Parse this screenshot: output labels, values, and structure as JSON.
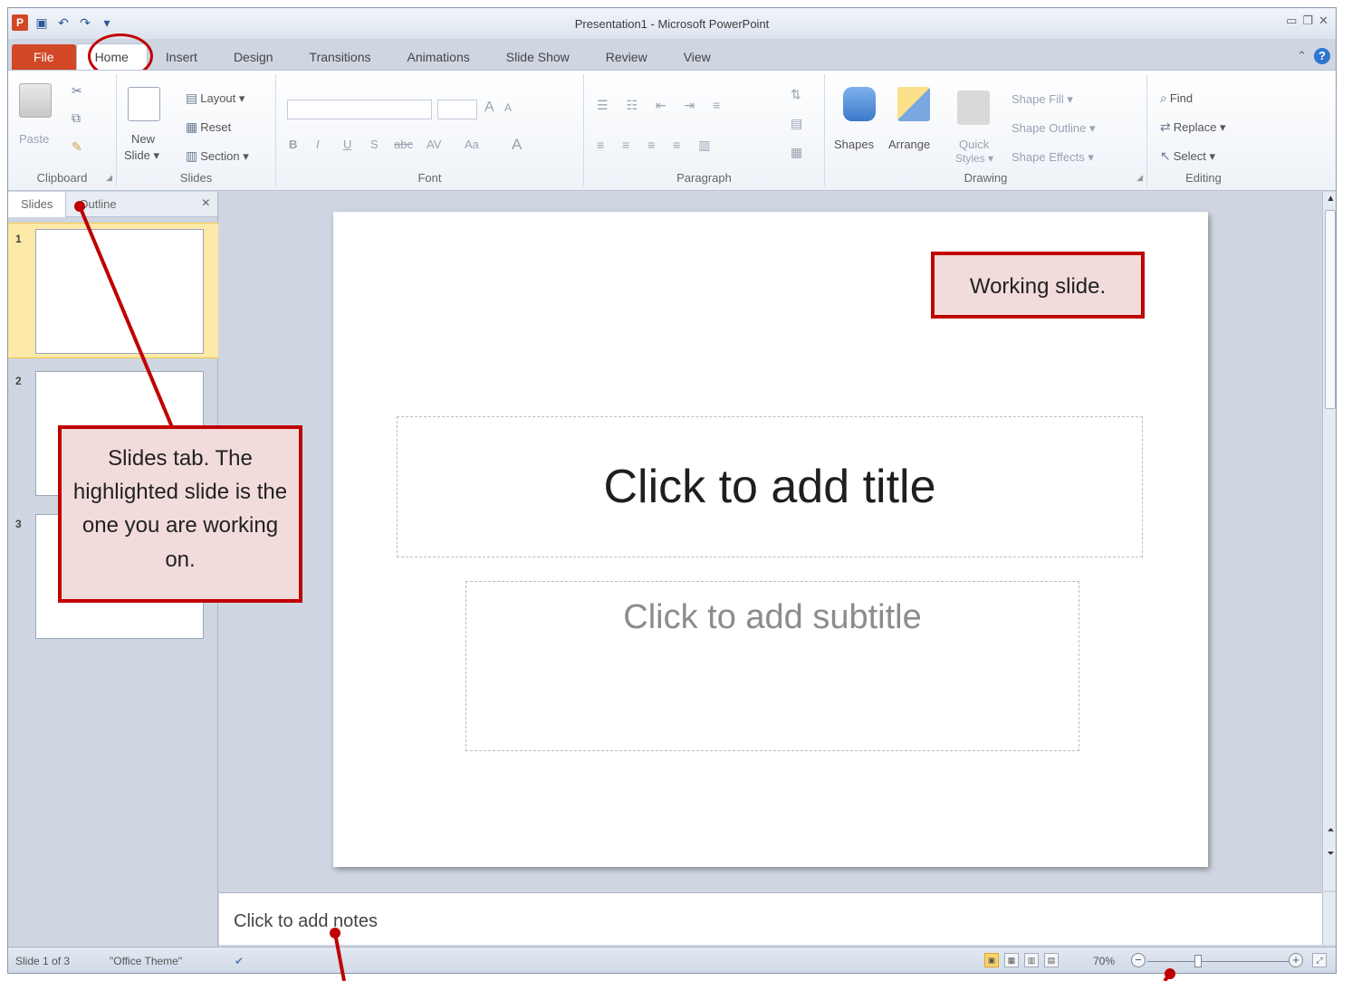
{
  "window": {
    "title": "Presentation1 - Microsoft PowerPoint"
  },
  "ribbon_tabs": [
    "File",
    "Home",
    "Insert",
    "Design",
    "Transitions",
    "Animations",
    "Slide Show",
    "Review",
    "View"
  ],
  "ribbon": {
    "clipboard": {
      "label": "Clipboard",
      "paste": "Paste"
    },
    "slides": {
      "label": "Slides",
      "new_slide_line1": "New",
      "new_slide_line2": "Slide ▾",
      "layout": "Layout ▾",
      "reset": "Reset",
      "section": "Section ▾"
    },
    "font": {
      "label": "Font",
      "bold": "B",
      "italic": "I",
      "underline": "U",
      "strike": "S",
      "abc": "abc",
      "spacing": "AV",
      "case": "Aa",
      "color": "A",
      "grow": "A",
      "shrink": "A"
    },
    "paragraph": {
      "label": "Paragraph"
    },
    "drawing": {
      "label": "Drawing",
      "shapes": "Shapes",
      "arrange": "Arrange",
      "quick_styles_line1": "Quick",
      "quick_styles_line2": "Styles ▾",
      "shape_fill": "Shape Fill ▾",
      "shape_outline": "Shape Outline ▾",
      "shape_effects": "Shape Effects ▾"
    },
    "editing": {
      "label": "Editing",
      "find": "Find",
      "replace": "Replace ▾",
      "select": "Select ▾"
    }
  },
  "left_panel": {
    "tabs": [
      "Slides",
      "Outline"
    ],
    "close": "×",
    "slides": [
      "1",
      "2",
      "3"
    ]
  },
  "slide": {
    "title_placeholder": "Click to add title",
    "subtitle_placeholder": "Click to add subtitle"
  },
  "notes": {
    "placeholder": "Click to add notes"
  },
  "status": {
    "slide_info": "Slide 1 of 3",
    "theme": "\"Office Theme\"",
    "zoom": "70%",
    "zoom_minus": "−",
    "zoom_plus": "+"
  },
  "annotations": {
    "working_slide": "Working slide.",
    "slides_tab": "Slides tab. The highlighted slide is the one you are working on."
  },
  "colors": {
    "file_tab": "#d24726",
    "annotation_border": "#c00000",
    "annotation_fill": "#f2dcdb",
    "selected_thumb": "#fde9a8"
  },
  "icons": [
    "powerpoint-logo-icon",
    "save-icon",
    "undo-icon",
    "redo-icon",
    "customize-qat-icon",
    "minimize-icon",
    "restore-icon",
    "close-icon",
    "help-icon",
    "ribbon-collapse-icon",
    "paste-icon",
    "cut-icon",
    "copy-icon",
    "format-painter-icon",
    "new-slide-icon",
    "shapes-icon",
    "arrange-icon",
    "quick-styles-icon",
    "find-icon",
    "replace-icon",
    "select-icon",
    "spell-check-icon",
    "normal-view-icon",
    "slide-sorter-icon",
    "reading-view-icon",
    "slideshow-icon",
    "fit-window-icon"
  ]
}
